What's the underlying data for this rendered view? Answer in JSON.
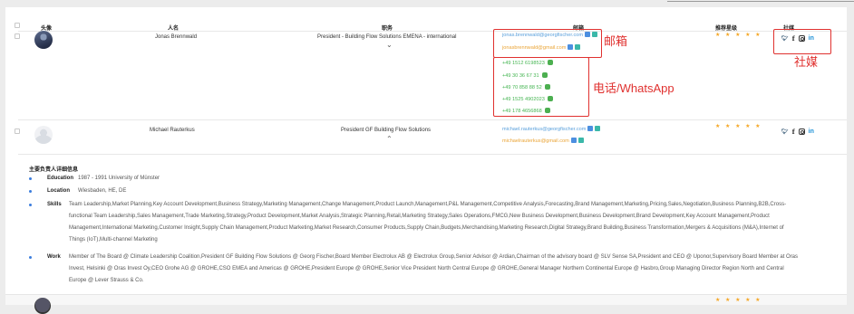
{
  "headers": {
    "avatar": "头像",
    "name": "人名",
    "title": "职务",
    "email": "邮箱",
    "rating": "推荐星级",
    "social": "社媒"
  },
  "rows": [
    {
      "name": "Jonas Brennwald",
      "title": "President - Building Flow Solutions EMENA - international",
      "emails": [
        "jonas.brennwald@georgfischer.com",
        "jonasbrennwald@gmail.com"
      ],
      "phones": [
        "+49 1512 6198523",
        "+49 30 36 67 31",
        "+49 70 858 88 52",
        "+49 1525 4902023",
        "+49 178 4656868"
      ],
      "stars": "★ ★ ★ ★ ★",
      "expand_icon": "chevron-down-icon"
    },
    {
      "name": "Michael Rauterkus",
      "title": "President GF Building Flow Solutions",
      "emails": [
        "michael.rauterkus@georgfischer.com",
        "michaelrauterkus@gmail.com"
      ],
      "stars": "★ ★ ★ ★ ★",
      "expand_icon": "chevron-up-icon"
    }
  ],
  "social_icons": {
    "twitter": "twitter-icon",
    "facebook": "f",
    "instagram": "instagram-icon",
    "linkedin": "in"
  },
  "annotations": {
    "email": "邮箱",
    "social": "社媒",
    "phone": "电话/WhatsApp"
  },
  "detail": {
    "title": "主要负责人详细信息",
    "education_label": "Education",
    "education_value": "1987 - 1991 University of Münster",
    "location_label": "Location",
    "location_value": "Wiesbaden, HE, DE",
    "skills_label": "Skills",
    "skills_value": "Team Leadership,Market Planning,Key Account Development,Business Strategy,Marketing Management,Change Management,Product Launch,Management,P&L Management,Competitive Analysis,Forecasting,Brand Management,Marketing,Pricing,Sales,Negotiation,Business Planning,B2B,Cross-functional Team Leadership,Sales Management,Trade Marketing,Strategy,Product Development,Market Analysis,Strategic Planning,Retail,Marketing Strategy,Sales Operations,FMCG,New Business Development,Business Development,Brand Development,Key Account Management,Product Management,International Marketing,Customer Insight,Supply Chain Management,Product Marketing,Market Research,Consumer Products,Supply Chain,Budgets,Merchandising,Marketing Research,Digital Strategy,Brand Building,Business Transformation,Mergers & Acquisitions (M&A),Internet of Things (IoT),Multi-channel Marketing",
    "work_label": "Work",
    "work_value": "Member of The Board @ Climate Leadership Coalition,President GF Building Flow Solutions @ Georg Fischer,Board Member Electrolux AB @ Electrolux Group,Senior Advisor @ Ardian,Chairman of the advisory board @ SLV Sense SA,President and CEO @ Uponor,Supervisory Board Member at Oras Invest, Helsinki @ Oras Invest Oy,CEO Grohe AG @ GROHE,CSO EMEA and Americas @ GROHE,President Europe @ GROHE,Senior Vice President North Central Europe @ GROHE,General Manager Northern Continental Europe @ Hasbro,Group Managing Director Region North and Central Europe @ Lever Strauss & Co."
  },
  "third_row_stars": "★ ★ ★ ★ ★"
}
